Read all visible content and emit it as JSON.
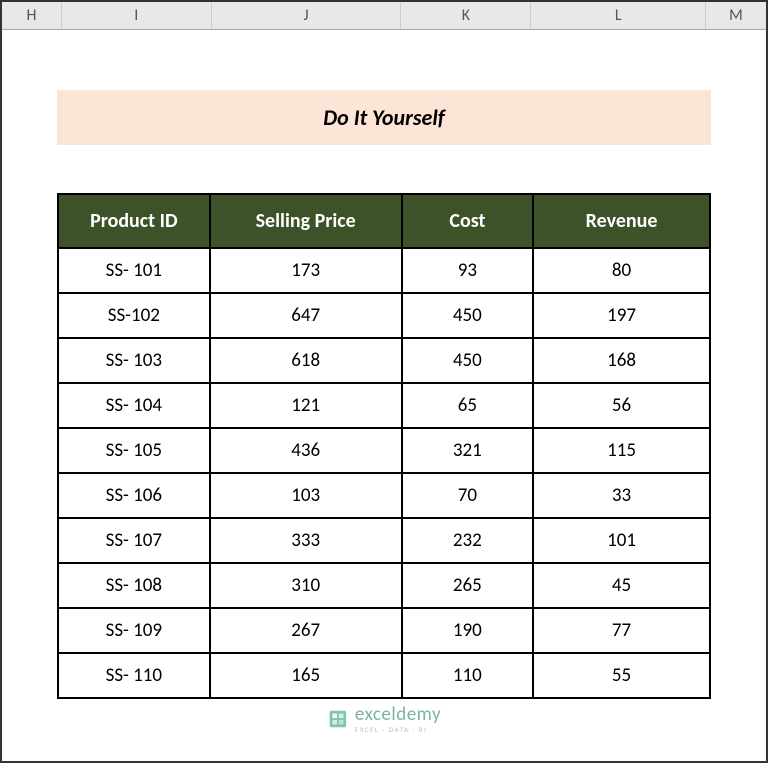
{
  "columns": {
    "h": "H",
    "i": "I",
    "j": "J",
    "k": "K",
    "l": "L",
    "m": "M"
  },
  "title": "Do It Yourself",
  "headers": {
    "product_id": "Product ID",
    "selling_price": "Selling Price",
    "cost": "Cost",
    "revenue": "Revenue"
  },
  "rows": [
    {
      "product_id": "SS- 101",
      "selling_price": "173",
      "cost": "93",
      "revenue": "80"
    },
    {
      "product_id": "SS-102",
      "selling_price": "647",
      "cost": "450",
      "revenue": "197"
    },
    {
      "product_id": "SS- 103",
      "selling_price": "618",
      "cost": "450",
      "revenue": "168"
    },
    {
      "product_id": "SS- 104",
      "selling_price": "121",
      "cost": "65",
      "revenue": "56"
    },
    {
      "product_id": "SS- 105",
      "selling_price": "436",
      "cost": "321",
      "revenue": "115"
    },
    {
      "product_id": "SS- 106",
      "selling_price": "103",
      "cost": "70",
      "revenue": "33"
    },
    {
      "product_id": "SS- 107",
      "selling_price": "333",
      "cost": "232",
      "revenue": "101"
    },
    {
      "product_id": "SS- 108",
      "selling_price": "310",
      "cost": "265",
      "revenue": "45"
    },
    {
      "product_id": "SS- 109",
      "selling_price": "267",
      "cost": "190",
      "revenue": "77"
    },
    {
      "product_id": "SS- 110",
      "selling_price": "165",
      "cost": "110",
      "revenue": "55"
    }
  ],
  "watermark": {
    "main": "exceldemy",
    "sub": "EXCEL · DATA · BI"
  },
  "chart_data": {
    "type": "table",
    "title": "Do It Yourself",
    "columns": [
      "Product ID",
      "Selling Price",
      "Cost",
      "Revenue"
    ],
    "data": [
      [
        "SS- 101",
        173,
        93,
        80
      ],
      [
        "SS-102",
        647,
        450,
        197
      ],
      [
        "SS- 103",
        618,
        450,
        168
      ],
      [
        "SS- 104",
        121,
        65,
        56
      ],
      [
        "SS- 105",
        436,
        321,
        115
      ],
      [
        "SS- 106",
        103,
        70,
        33
      ],
      [
        "SS- 107",
        333,
        232,
        101
      ],
      [
        "SS- 108",
        310,
        265,
        45
      ],
      [
        "SS- 109",
        267,
        190,
        77
      ],
      [
        "SS- 110",
        165,
        110,
        55
      ]
    ]
  }
}
